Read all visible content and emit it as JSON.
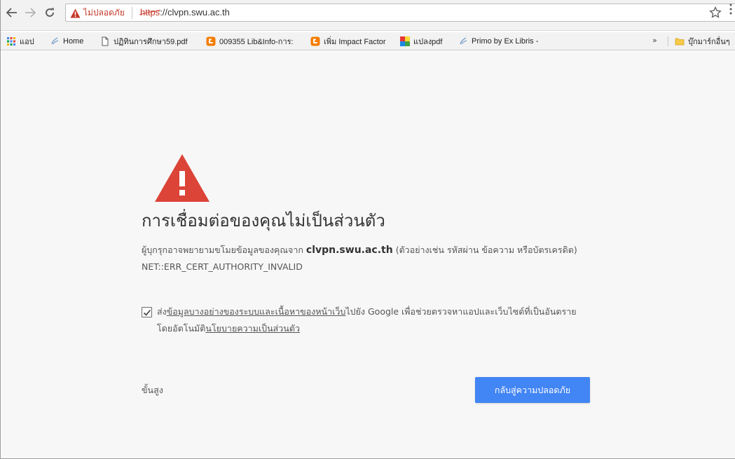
{
  "toolbar": {
    "security_label": "ไม่ปลอดภัย",
    "url_scheme": "https",
    "url_rest": "://clvpn.swu.ac.th"
  },
  "bookmarks": {
    "items": [
      {
        "label": "แอป",
        "icon": "apps-grid-icon"
      },
      {
        "label": "Home",
        "icon": "ebsco-icon"
      },
      {
        "label": "ปฏิทินการศึกษา59.pdf",
        "icon": "document-icon"
      },
      {
        "label": "009355 Lib&Info-การ:",
        "icon": "blogger-icon"
      },
      {
        "label": "เพิ่ม Impact Factor",
        "icon": "blogger-icon"
      },
      {
        "label": "แปลงpdf",
        "icon": "colorful-grid-icon"
      },
      {
        "label": "Primo by Ex Libris -",
        "icon": "ebsco-icon"
      }
    ],
    "more": "»",
    "other_bookmarks": "บุ๊กมาร์กอื่นๆ"
  },
  "page": {
    "heading": "การเชื่อมต่อของคุณไม่เป็นส่วนตัว",
    "body_part1": "ผู้บุกรุกอาจพยายามขโมยข้อมูลของคุณจาก ",
    "body_host": "clvpn.swu.ac.th",
    "body_part2": " (ตัวอย่างเช่น รหัสผ่าน ข้อความ หรือบัตรเครดิต) NET::ERR_CERT_AUTHORITY_INVALID",
    "checkbox_pre": "ส่ง",
    "checkbox_link1": "ข้อมูลบางอย่างของระบบและเนื้อหาของหน้าเว็บ",
    "checkbox_mid": "ไปยัง Google เพื่อช่วยตรวจหาแอปและเว็บไซต์ที่เป็นอันตรายโดยอัตโนมัติ",
    "checkbox_link2": "นโยบายความเป็นส่วนตัว",
    "checkbox_checked": true,
    "advanced_label": "ขั้นสูง",
    "back_button_label": "กลับสู่ความปลอดภัย"
  },
  "colors": {
    "danger": "#c53929",
    "warning_icon": "#db4437",
    "primary_button": "#4285f4",
    "page_bg": "#f7f7f7"
  }
}
